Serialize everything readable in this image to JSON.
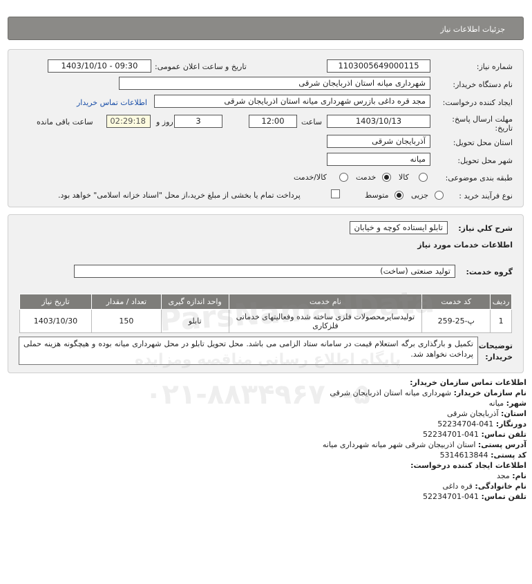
{
  "header": {
    "title": "جزئیات اطلاعات نیاز"
  },
  "details": {
    "need_number": {
      "label": "شماره نیاز:",
      "value": "1103005649000115"
    },
    "announce": {
      "label": "تاریخ و ساعت اعلان عمومی:",
      "value": "1403/10/10 - 09:30"
    },
    "buyer": {
      "label": "نام دستگاه خریدار:",
      "value": "شهرداری میانه استان اذربایجان شرقی"
    },
    "creator": {
      "label": "ایجاد کننده درخواست:",
      "value": "مجد قره داغی بازرس شهرداری میانه استان اذربایجان شرقی",
      "link": "اطلاعات تماس خریدار"
    },
    "deadline": {
      "label": "مهلت ارسال پاسخ: تا تاریخ:",
      "label_line1": "مهلت ارسال پاسخ:",
      "label_line2": "تاریخ:",
      "date": "1403/10/13",
      "time_label": "ساعت",
      "time": "12:00",
      "days": "3",
      "days_label": "روز و",
      "remaining": "02:29:18",
      "remaining_label": "ساعت باقی مانده"
    },
    "province": {
      "label": "استان محل تحویل:",
      "value": "آذربایجان شرقی"
    },
    "city": {
      "label": "شهر محل تحویل:",
      "value": "میانه"
    },
    "category": {
      "label": "طبقه بندی موضوعی:",
      "options": [
        "کالا",
        "خدمت",
        "کالا/خدمت"
      ],
      "selected": "خدمت"
    },
    "process": {
      "label": "نوع فرآیند خرید :",
      "options": [
        "جزیی",
        "متوسط"
      ],
      "selected": "متوسط",
      "payment_note": "پرداخت تمام یا بخشی از مبلغ خرید،از محل \"اسناد خزانه اسلامی\" خواهد بود."
    }
  },
  "summary": {
    "label": "شرح کلي نیاز:",
    "value": "تابلو ایستاده کوچه و خیابان",
    "services_heading": "اطلاعات خدمات مورد نیاز",
    "group_label": "گروه خدمت:",
    "group_value": "تولید صنعتی (ساخت)",
    "table": {
      "headers": [
        "ردیف",
        "کد خدمت",
        "نام خدمت",
        "واحد اندازه گیری",
        "تعداد / مقدار",
        "تاریخ نیاز"
      ],
      "rows": [
        [
          "1",
          "پ-25-259",
          "تولیدسایرمحصولات فلزی ساخته شده وفعالیتهای خدماتی فلزکاری",
          "تابلو",
          "150",
          "1403/10/30"
        ]
      ]
    },
    "note_label": "توضیحات خریدار:",
    "note_label_line1": "توضیحات",
    "note_label_line2": "خریدار:",
    "note": "تکمیل و بارگذاری برگه استعلام قیمت در سامانه ستاد الزامی می باشد. محل تحویل تابلو در محل شهرداری میانه بوده و هیچگونه هزینه حملی پرداخت نخواهد شد."
  },
  "contact": {
    "heading": "اطلاعات تماس سازمان خریدار:",
    "org_label": "نام سازمان خریدار:",
    "org": "شهرداری میانه استان اذربایجان شرقی",
    "city_label": "شهر:",
    "city": "میانه",
    "province_label": "استان:",
    "province": "آذربایجان شرقی",
    "fax_label": "دورنگار:",
    "fax": "041-52234704",
    "phone_label": "تلفن تماس:",
    "phone": "041-52234701",
    "address_label": "آدرس پستی:",
    "address": "استان اذربیجان شرقی شهر میانه شهرداری میانه",
    "postal_label": "کد پستی:",
    "postal": "5314613844",
    "creator_heading": "اطلاعات ایجاد کننده درخواست:",
    "name_label": "نام:",
    "name": "مجد",
    "family_label": "نام خانوادگی:",
    "family": "قره داغی",
    "creator_phone_label": "تلفن تماس:",
    "creator_phone": "041-52234701"
  },
  "watermark": {
    "brand": "ParsNamadData",
    "line": "پایگاه اطلاع رسانی مناقصه ومزایده",
    "phone": "۰۲۱-۸۸۳۴۹۶۷۰-۵"
  }
}
